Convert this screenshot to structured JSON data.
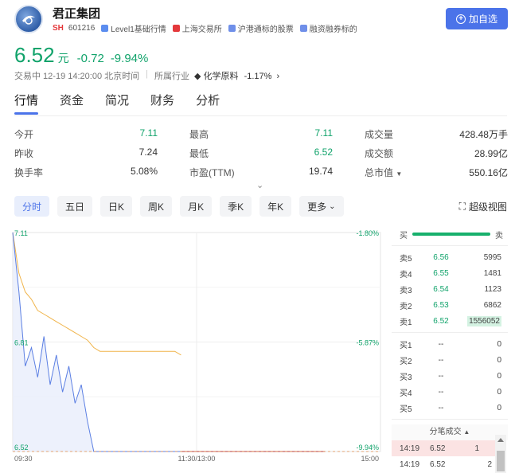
{
  "header": {
    "company_name": "君正集团",
    "market": "SH",
    "code": "601216",
    "tags": [
      {
        "label": "Level1基础行情",
        "color": "#5b8def",
        "icon": "level1-icon"
      },
      {
        "label": "上海交易所",
        "color": "#e4393c",
        "icon": "china-flag-icon"
      },
      {
        "label": "沪港通标的股票",
        "color": "#6f8fe9",
        "icon": "hk-connect-icon"
      },
      {
        "label": "融资融券标的",
        "color": "#6f8fe9",
        "icon": "margin-icon"
      }
    ],
    "add_button_label": "加自选"
  },
  "quote": {
    "price": "6.52",
    "unit": "元",
    "change": "-0.72",
    "change_pct": "-9.94%",
    "status_time": "交易中 12-19 14:20:00 北京时间",
    "industry_label": "所属行业",
    "industry_name": "化学原料",
    "industry_change": "-1.17%"
  },
  "tabs": [
    "行情",
    "资金",
    "简况",
    "财务",
    "分析"
  ],
  "stats": [
    [
      {
        "k": "今开",
        "v": "7.11",
        "green": true
      },
      {
        "k": "最高",
        "v": "7.11",
        "green": true
      },
      {
        "k": "成交量",
        "v": "428.48万手",
        "green": false
      }
    ],
    [
      {
        "k": "昨收",
        "v": "7.24",
        "green": false
      },
      {
        "k": "最低",
        "v": "6.52",
        "green": true
      },
      {
        "k": "成交额",
        "v": "28.99亿",
        "green": false
      }
    ],
    [
      {
        "k": "换手率",
        "v": "5.08%",
        "green": false
      },
      {
        "k": "市盈(TTM)",
        "v": "19.74",
        "green": false
      },
      {
        "k": "总市值",
        "v": "550.16亿",
        "green": false
      }
    ]
  ],
  "periods": [
    "分时",
    "五日",
    "日K",
    "周K",
    "月K",
    "季K",
    "年K",
    "更多"
  ],
  "super_view_label": "超级视图",
  "chart_data": {
    "type": "line",
    "x_labels": [
      "09:30",
      "11:30/13:00",
      "15:00"
    ],
    "y_left_labels": [
      "7.11",
      "6.81",
      "6.52"
    ],
    "y_right_labels": [
      "-1.80%",
      "-5.87%",
      "-9.94%"
    ],
    "ylim": [
      6.52,
      7.11
    ],
    "series": [
      {
        "color": "#f0b44a",
        "values": [
          7.11,
          7.0,
          6.95,
          6.93,
          6.9,
          6.89,
          6.88,
          6.87,
          6.86,
          6.85,
          6.84,
          6.83,
          6.82,
          6.8,
          6.79,
          6.79,
          6.79,
          6.79,
          6.79,
          6.79,
          6.79,
          6.79,
          6.79,
          6.79,
          6.79,
          6.79,
          6.79,
          6.78
        ]
      },
      {
        "color": "#5b7fe3",
        "values": [
          7.11,
          6.95,
          6.75,
          6.8,
          6.72,
          6.83,
          6.7,
          6.78,
          6.68,
          6.75,
          6.65,
          6.7,
          6.6,
          6.52,
          6.52,
          6.52,
          6.52,
          6.52,
          6.52,
          6.52,
          6.52,
          6.52,
          6.52,
          6.52,
          6.52,
          6.52,
          6.52,
          6.52
        ]
      }
    ],
    "limit_down": 6.52
  },
  "order_book": {
    "buy_label": "买",
    "sell_label": "卖",
    "asks": [
      {
        "label": "卖5",
        "price": "6.56",
        "qty": "5995"
      },
      {
        "label": "卖4",
        "price": "6.55",
        "qty": "1481"
      },
      {
        "label": "卖3",
        "price": "6.54",
        "qty": "1123"
      },
      {
        "label": "卖2",
        "price": "6.53",
        "qty": "6862"
      },
      {
        "label": "卖1",
        "price": "6.52",
        "qty": "1556052"
      }
    ],
    "bids": [
      {
        "label": "买1",
        "price": "--",
        "qty": "0"
      },
      {
        "label": "买2",
        "price": "--",
        "qty": "0"
      },
      {
        "label": "买3",
        "price": "--",
        "qty": "0"
      },
      {
        "label": "买4",
        "price": "--",
        "qty": "0"
      },
      {
        "label": "买5",
        "price": "--",
        "qty": "0"
      }
    ],
    "ticks_title": "分笔成交",
    "ticks": [
      {
        "time": "14:19",
        "price": "6.52",
        "vol": "1"
      },
      {
        "time": "14:19",
        "price": "6.52",
        "vol": "2"
      }
    ]
  }
}
